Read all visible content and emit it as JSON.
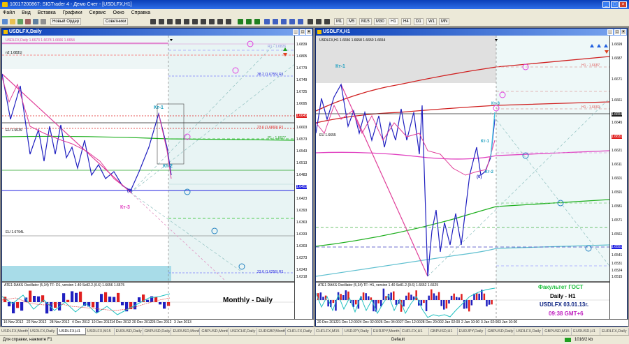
{
  "window": {
    "title": "10017200867: SIGTrader 4 - Демо Счет - [USDLFX,H1]"
  },
  "menu": [
    "Файл",
    "Вид",
    "Вставка",
    "Графики",
    "Сервис",
    "Окно",
    "Справка"
  ],
  "toolbar": {
    "new_order": "Новый Ордер",
    "advisors": "Советники",
    "periods": [
      "M1",
      "M5",
      "M15",
      "M30",
      "H1",
      "H4",
      "D1",
      "W1",
      "MN"
    ]
  },
  "daily": {
    "title": "USDLFX,Daily",
    "legend": "USDLFX,Daily 1.6673 1.6678 1.6666 1.6654",
    "price_labels": [
      "1.6839",
      "1.6805",
      "1.6779",
      "1.6749",
      "1.6725",
      "1.6695",
      "1.6645",
      "1.6603",
      "1.6573",
      "1.6543",
      "1.6513",
      "1.6483",
      "1.6453",
      "1.6423",
      "1.6393",
      "1.6363",
      "1.6333",
      "1.6303",
      "1.6273",
      "1.6243",
      "1.6218"
    ],
    "annotations": {
      "kt1": "Кт-1",
      "kt2": "Кт-2",
      "kt3": "Кт-3",
      "zero": "(0)",
      "n2": "n2 1.6831|",
      "eu": "EU 1.6639",
      "eu2": "EU 1.6794L",
      "r1": "R1 - 1.6826",
      "p": "P1 - 1.6677",
      "l1": "38.2 (1.6755) R1",
      "l2": "23.6 (1.6669) R1",
      "l3": "23.6 (1.6256) R1"
    },
    "osc_label": "ATE1 DAKS Oscillator (5,34) TF: D1, version 1.40 Sell2.2.(0.6) 1.6656 1.6575",
    "dates": [
      "16 Nov 2012",
      "22 Nov 2012",
      "28 Nov 2012",
      "4 Dec 2012",
      "10 Dec 2012",
      "14 Dec 2012",
      "20 Dec 2012",
      "26 Dec 2012",
      "3 Jan 2013"
    ],
    "overlay": "Monthly - Daily"
  },
  "hourly": {
    "title": "USDLFX,H1",
    "legend": "USDLFX,H1 1.6656 1.6658 1.6650 1.6654",
    "price_labels": [
      "1.6699",
      "1.6687",
      "1.6671",
      "1.6661",
      "1.6654",
      "1.6645",
      "1.6631",
      "1.6621",
      "1.6611",
      "1.6601",
      "1.6591",
      "1.6581",
      "1.6571",
      "1.6561",
      "1.6551",
      "1.6541",
      "1.6531",
      "1.6524",
      "1.6515"
    ],
    "annotations": {
      "kt1": "Кт-1",
      "kt2": "Кт-2",
      "kt3": "Кт-3",
      "kt_1": "Кт-1",
      "zero": "(0)",
      "eu": "EU 1.6655",
      "h1": "H1 - 1.6687",
      "h1b": "H1 - 1.6669"
    },
    "osc_label": "ATE1 DAKS Oscillator (5,34) TF: H1, version 1.40 Sell1.2.(0.6) 1.6652 1.6625",
    "dates": [
      "20 Dec 2012",
      "21 Dec 12:00",
      "24 Dec 02:00",
      "26 Dec 04:00",
      "27 Dec 12:00",
      "28 Dec 20:00",
      "2 Jan 02:00",
      "2 Jan 10:00",
      "3 Jan 02:00",
      "3 Jan 10:00"
    ],
    "overlay": {
      "line1": "Факультет ГОСТ",
      "line2": "Daily - H1",
      "line3": "USDLFX 03.01.13г.",
      "line4": "09:38  GMT+6"
    }
  },
  "tabs": [
    "USDLFX,Monthly",
    "USDLFX,Daily",
    "USDLFX,H1",
    "USDLFX,M15",
    "EURUSD,Daily",
    "GBPUSD,Daily",
    "EURUSD,Monthly",
    "GBPUSD,Monthly",
    "USDCHF,Daily",
    "EURGBP,Monthly",
    "CHFLFX,Daily",
    "CHFLFX,M15",
    "USDJPY,Daily",
    "EURJPY,Monthly",
    "CHFLFX,H1",
    "GBPUSD,H1",
    "EURJPY,Daily",
    "GBPUSD,Daily",
    "USDLFX,Daily",
    "GBPUSD,M15",
    "EURUSD,H1",
    "EURLFX,Daily"
  ],
  "active_tab": 2,
  "status": {
    "help": "Для справки, нажмите F1",
    "profile": "Default",
    "traffic": "1016/2 kb"
  },
  "colors": {
    "title_blue": "#0a3fb8",
    "pink": "#e0409a",
    "blue": "#2020c0",
    "cyan": "#20a0c0",
    "green_text": "#20c040",
    "magenta_text": "#c020c0",
    "navy_text": "#0a2080"
  }
}
